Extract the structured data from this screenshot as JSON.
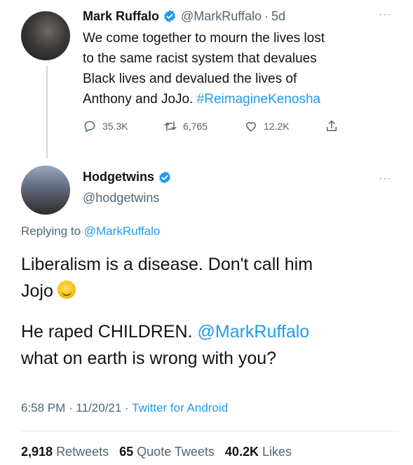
{
  "tweet1": {
    "name": "Mark Ruffalo",
    "handle": "@MarkRuffalo",
    "dot": "·",
    "time": "5d",
    "more": "···",
    "lines": [
      "We come together to mourn the lives lost",
      "to the same racist system that devalues",
      "Black lives and devalued the lives of"
    ],
    "last_line_text": "Anthony and JoJo. ",
    "hashtag": "#ReimagineKenosha",
    "actions": {
      "replies": "35.3K",
      "retweets": "6,765",
      "likes": "12.2K"
    }
  },
  "tweet2": {
    "name": "Hodgetwins",
    "handle": "@hodgetwins",
    "more": "···",
    "replying_label": "Replying to ",
    "replying_mention": "@MarkRuffalo",
    "para1_line1": "Liberalism is a disease. Don't call him",
    "para1_line2": "Jojo",
    "para2_line1_text": "He raped CHILDREN. ",
    "para2_mention": "@MarkRuffalo",
    "para2_line2": "what on earth is wrong with you?",
    "time": "6:58 PM · 11/20/21 · ",
    "source": "Twitter for Android",
    "stats": {
      "retweets_count": "2,918",
      "retweets_label": "Retweets",
      "quotes_count": "65",
      "quotes_label": "Quote Tweets",
      "likes_count": "40.2K",
      "likes_label": "Likes"
    }
  },
  "colors": {
    "link": "#1d9bf0",
    "secondary_text": "#536471",
    "verified": "#1d9bf0"
  }
}
